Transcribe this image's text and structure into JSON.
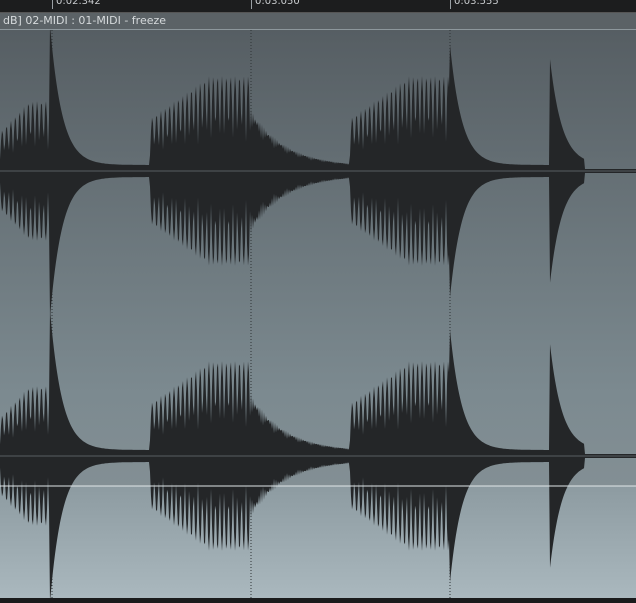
{
  "ruler": {
    "marks": [
      "0:02.342",
      "0:03.050",
      "0:03.555"
    ]
  },
  "item": {
    "title": "dB] 02-MIDI : 01-MIDI - freeze"
  },
  "colors": {
    "waveform": "#242628",
    "item_bg_top": "#565e63",
    "item_bg_bottom": "#a7b6bc",
    "ruler_bg": "#1c1d1e",
    "header_bg": "#5b6266",
    "centerline": "#8e979b",
    "divider": "#dfe5e7",
    "grid": "#2f3436"
  }
}
